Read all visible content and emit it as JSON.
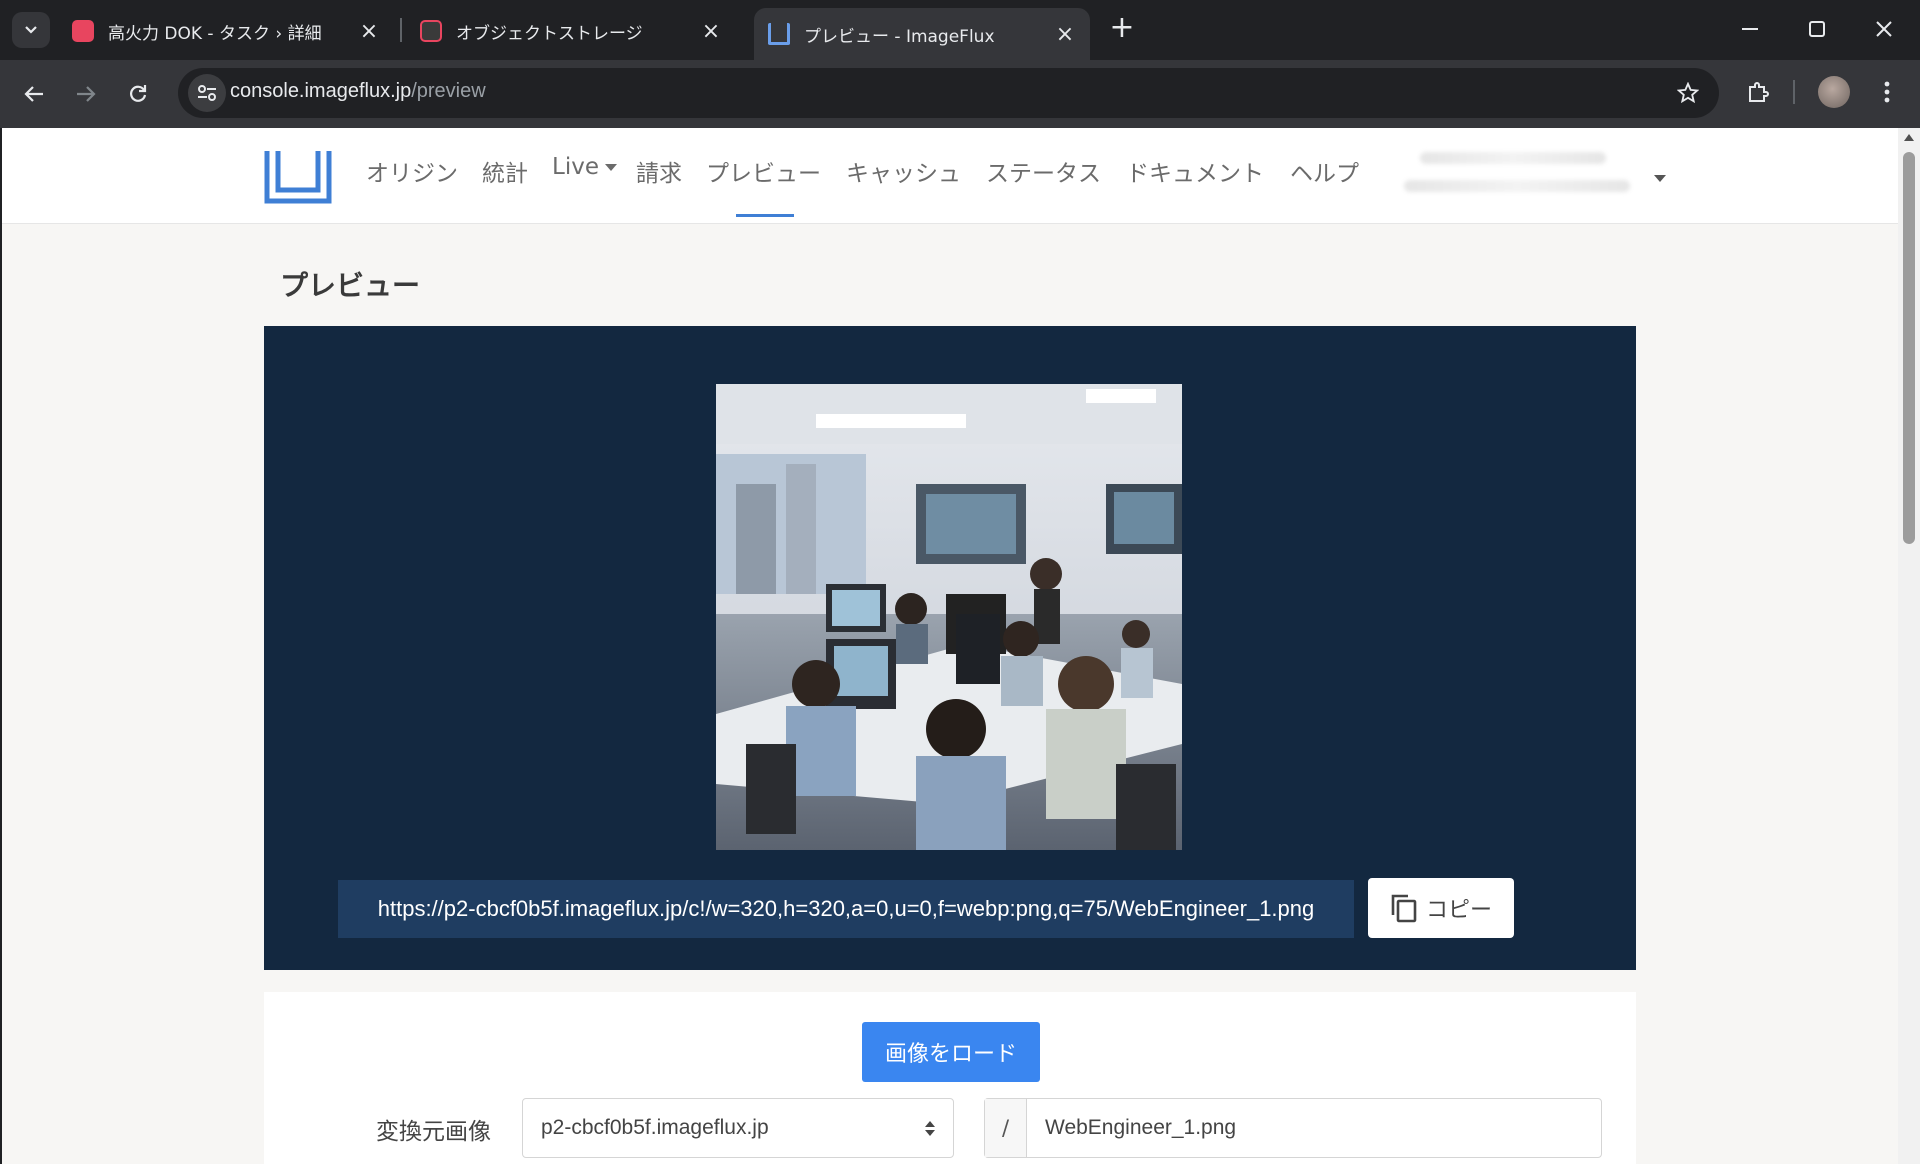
{
  "browser": {
    "tabs": [
      {
        "title": "高火力 DOK - タスク › 詳細",
        "favicon": "sakura-red-icon",
        "active": false
      },
      {
        "title": "オブジェクトストレージ",
        "favicon": "sakura-storage-icon",
        "active": false
      },
      {
        "title": "プレビュー - ImageFlux",
        "favicon": "imageflux-icon",
        "active": true
      }
    ],
    "url_host": "console.imageflux.jp",
    "url_path": "/preview"
  },
  "app": {
    "nav": [
      "オリジン",
      "統計",
      "Live",
      "請求",
      "プレビュー",
      "キャッシュ",
      "ステータス",
      "ドキュメント",
      "ヘルプ"
    ],
    "active_nav": "プレビュー",
    "brand_color": "#3f7fd5"
  },
  "page": {
    "title": "プレビュー",
    "preview_url": "https://p2-cbcf0b5f.imageflux.jp/c!/w=320,h=320,a=0,u=0,f=webp:png,q=75/WebEngineer_1.png",
    "copy_label": "コピー",
    "load_button": "画像をロード",
    "source_label": "変換元画像",
    "source_origin": "p2-cbcf0b5f.imageflux.jp",
    "path_separator": "/",
    "source_path": "WebEngineer_1.png"
  }
}
